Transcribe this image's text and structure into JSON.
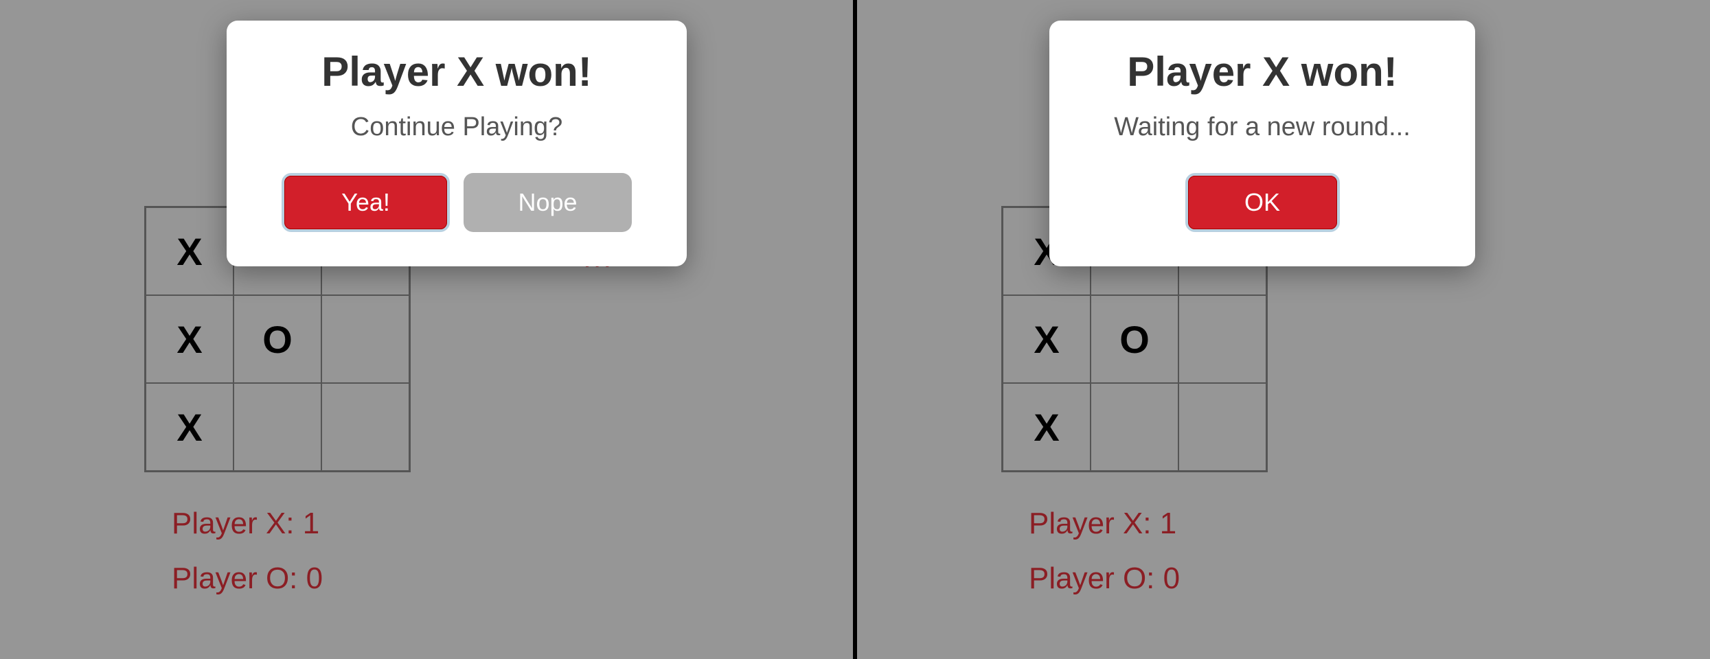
{
  "left": {
    "board": [
      [
        "X",
        "",
        ""
      ],
      [
        "X",
        "O",
        ""
      ],
      [
        "X",
        "",
        ""
      ]
    ],
    "turn_fragment": "rn",
    "score_x": "Player X: 1",
    "score_o": "Player O: 0",
    "modal": {
      "title": "Player X won!",
      "subtitle": "Continue Playing?",
      "yes_label": "Yea!",
      "no_label": "Nope"
    }
  },
  "right": {
    "board": [
      [
        "X",
        "",
        ""
      ],
      [
        "X",
        "O",
        ""
      ],
      [
        "X",
        "",
        ""
      ]
    ],
    "score_x": "Player X: 1",
    "score_o": "Player O: 0",
    "modal": {
      "title": "Player X won!",
      "subtitle": "Waiting for a new round...",
      "ok_label": "OK"
    }
  }
}
